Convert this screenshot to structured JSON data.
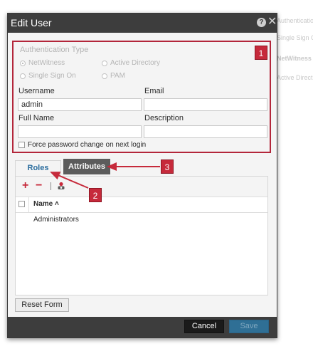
{
  "background_page": {
    "items": [
      "Authentication",
      "Single Sign On",
      "NetWitness",
      "Active Direct"
    ]
  },
  "dialog": {
    "title": "Edit User",
    "help_icon": "question-circle-icon",
    "close_icon": "close-x-icon"
  },
  "user_panel": {
    "legend": "Authentication Type",
    "auth_options": [
      {
        "label": "NetWitness",
        "selected": true
      },
      {
        "label": "Active Directory",
        "selected": false
      },
      {
        "label": "Single Sign On",
        "selected": false
      },
      {
        "label": "PAM",
        "selected": false
      }
    ],
    "username_label": "Username",
    "username_value": "admin",
    "email_label": "Email",
    "email_value": "",
    "fullname_label": "Full Name",
    "fullname_value": "",
    "description_label": "Description",
    "description_value": "",
    "force_password_label": "Force password change on next login",
    "force_password_checked": false
  },
  "callouts": [
    "1",
    "2",
    "3"
  ],
  "tabs": {
    "roles": "Roles",
    "attributes": "Attributes"
  },
  "roles_panel": {
    "toolbar": {
      "add": "+",
      "remove": "−",
      "separator": "|",
      "role_icon": "role-settings-icon"
    },
    "column_header": "Name ˄",
    "rows": [
      "Administrators"
    ]
  },
  "buttons": {
    "reset_form": "Reset Form",
    "cancel": "Cancel",
    "save": "Save"
  },
  "colors": {
    "highlight_red": "#c62a3b",
    "titlebar": "#3d3d3d",
    "tab_active_text": "#2b6d9e",
    "save_button": "#2f6f95"
  }
}
